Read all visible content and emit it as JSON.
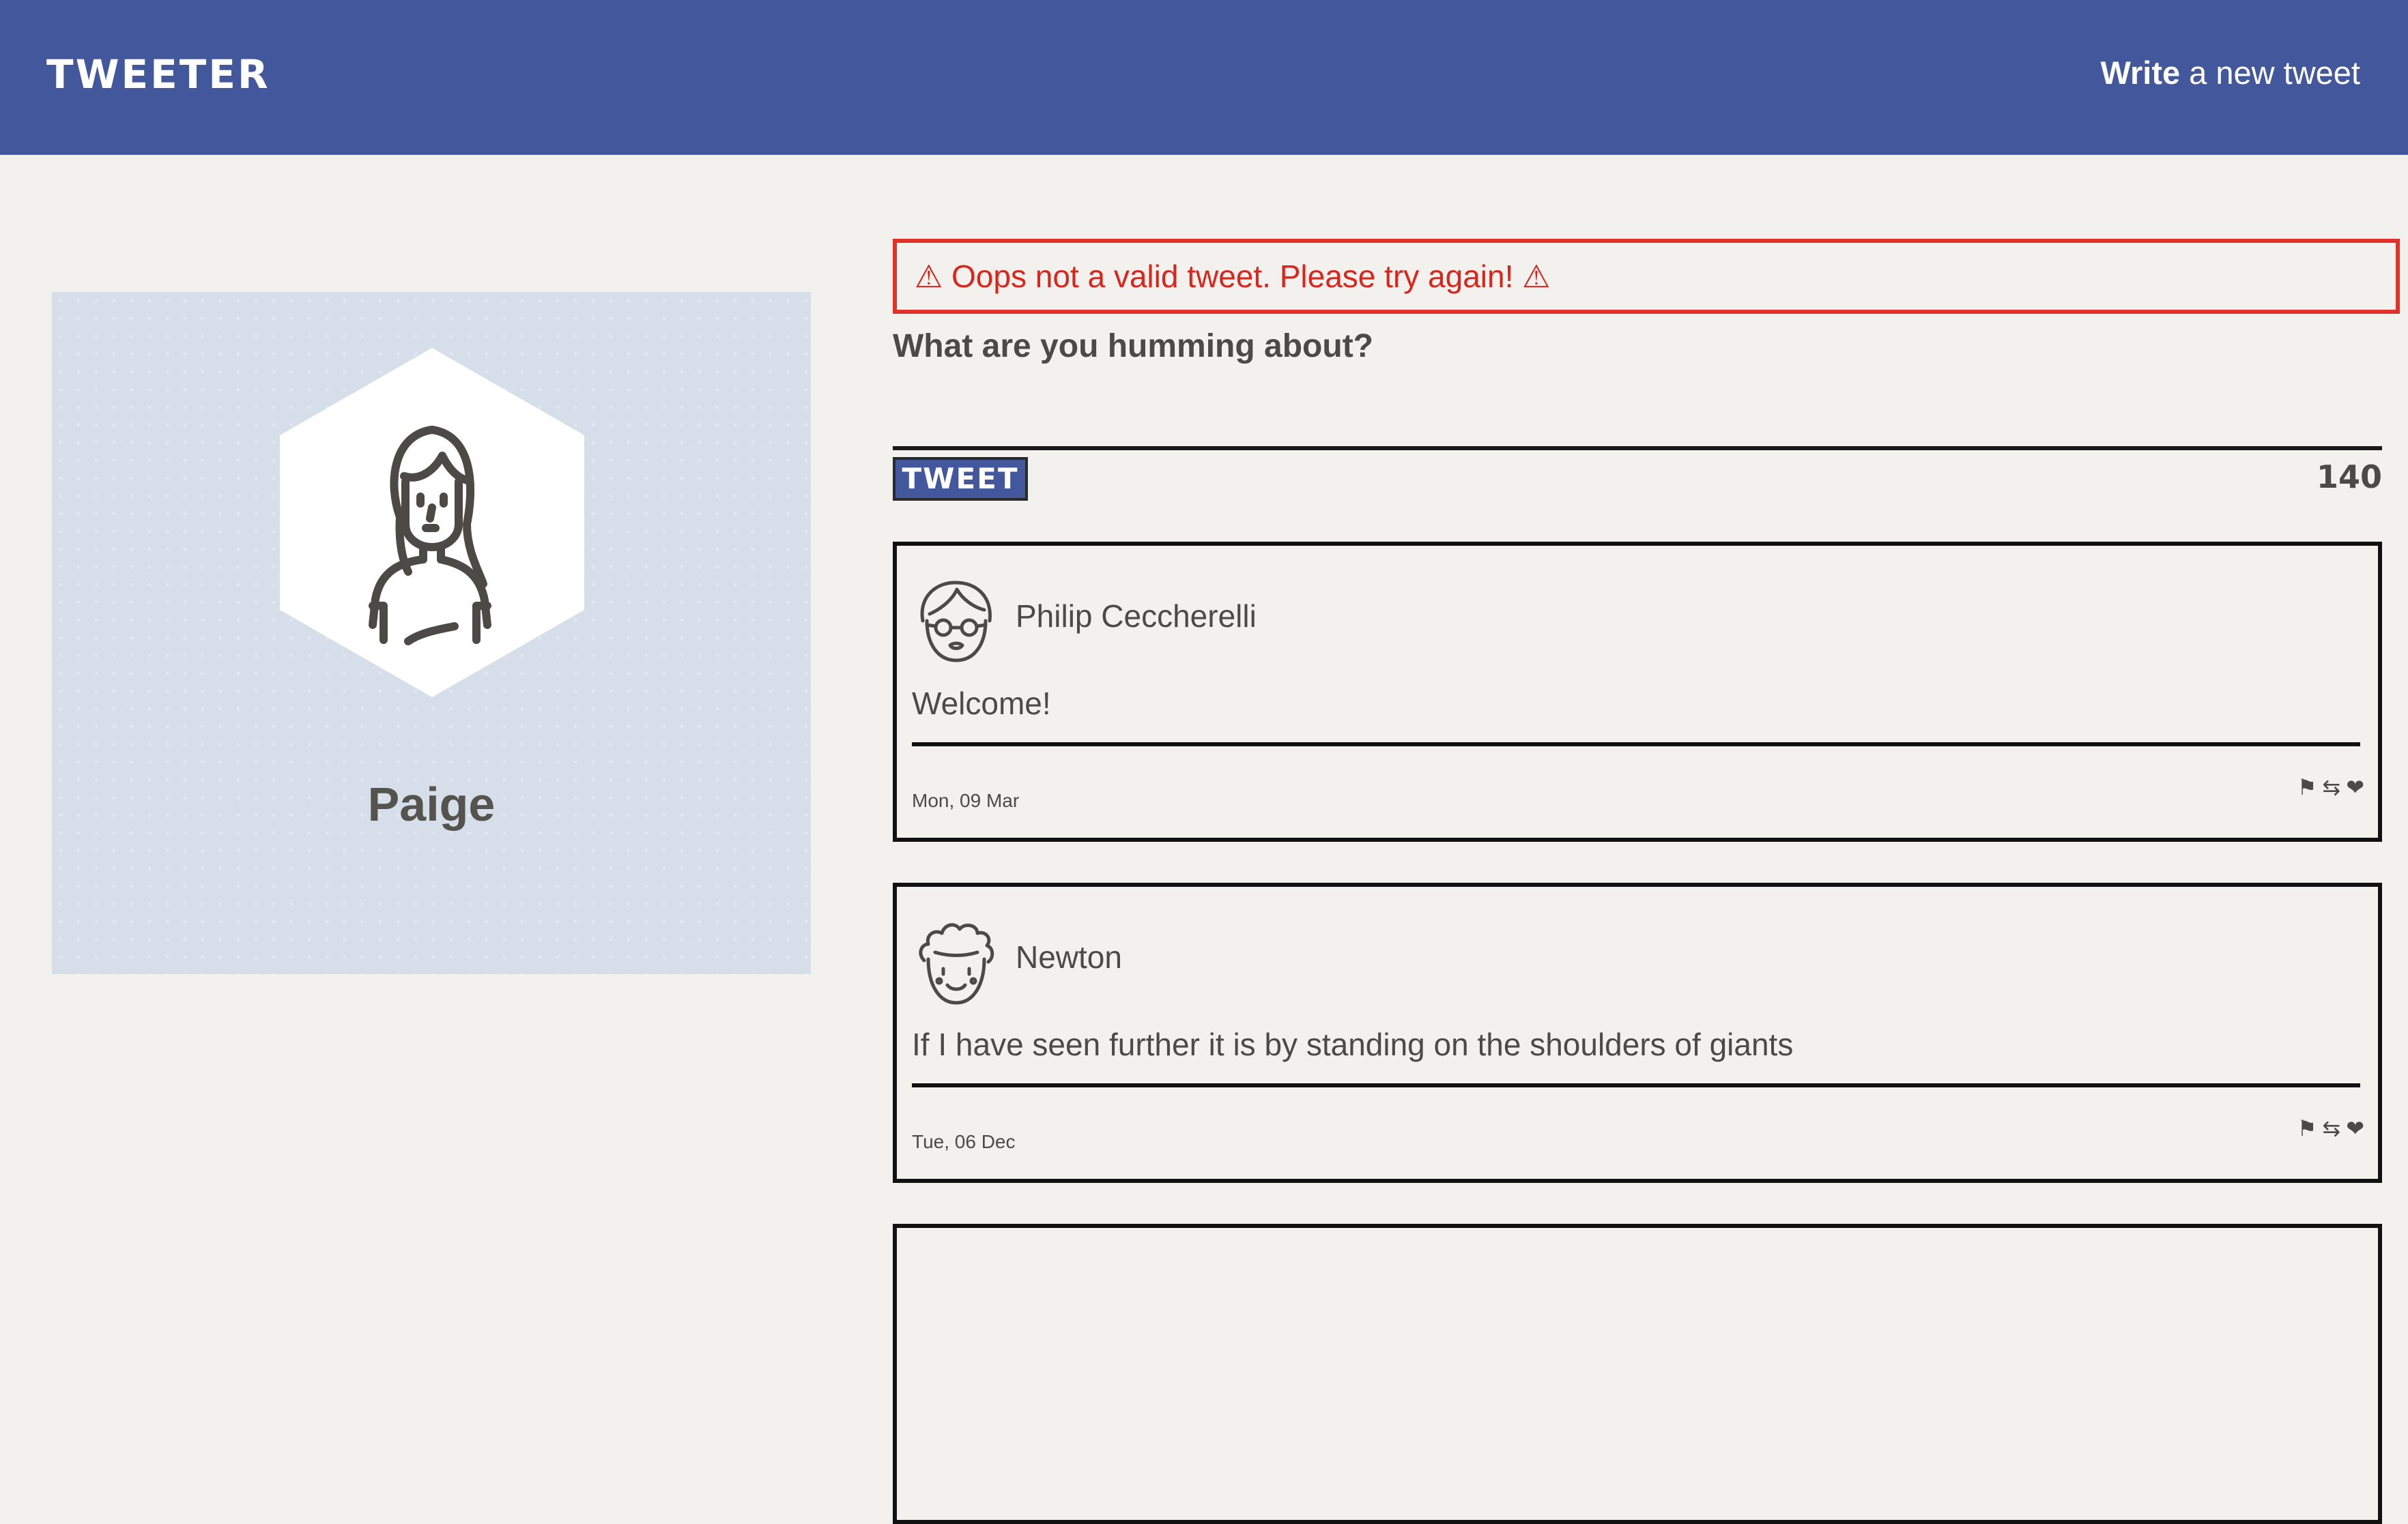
{
  "header": {
    "brand": "TWEETER",
    "compose_strong": "Write",
    "compose_rest": " a new tweet"
  },
  "profile": {
    "name": "Paige"
  },
  "composer": {
    "error": "⚠ Oops not a valid tweet. Please try again! ⚠",
    "prompt": "What are you humming about?",
    "textarea_value": "",
    "button_label": "TWEET",
    "counter": "140"
  },
  "tweets": [
    {
      "name": "Philip Ceccherelli",
      "body": "Welcome!",
      "date": "Mon, 09 Mar",
      "flag_icon": "⚑",
      "retweet_icon": "⇆",
      "like_icon": "❤"
    },
    {
      "name": "Newton",
      "body": "If I have seen further it is by standing on the shoulders of giants",
      "date": "Tue, 06 Dec",
      "flag_icon": "⚑",
      "retweet_icon": "⇆",
      "like_icon": "❤"
    }
  ],
  "colors": {
    "nav_bg": "#43579c",
    "page_bg": "#f2f1ed",
    "error_red": "#e0322a",
    "profile_bg": "#d6dfe9"
  },
  "icons": {
    "profile_avatar": "woman-avatar-icon",
    "tweet_1_avatar": "man-glasses-avatar-icon",
    "tweet_2_avatar": "curly-hair-avatar-icon",
    "flag": "flag-icon",
    "retweet": "retweet-icon",
    "like": "heart-icon"
  }
}
